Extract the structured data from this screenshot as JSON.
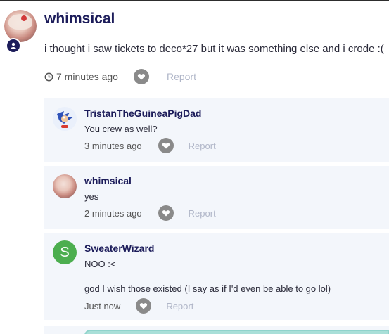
{
  "post": {
    "author": "whimsical",
    "text": "i thought i saw tickets to deco*27 but it was something else and i crode :(",
    "time": "7 minutes ago",
    "report_label": "Report"
  },
  "replies": [
    {
      "author": "TristanTheGuineaPigDad",
      "lines": [
        "You crew as well?"
      ],
      "time": "3 minutes ago",
      "report_label": "Report"
    },
    {
      "author": "whimsical",
      "lines": [
        "yes"
      ],
      "time": "2 minutes ago",
      "report_label": "Report"
    },
    {
      "author": "SweaterWizard",
      "avatar_letter": "S",
      "lines": [
        "NOO :<",
        "god I wish those existed (I say as if I'd even be able to go lol)"
      ],
      "time": "Just now",
      "report_label": "Report"
    }
  ],
  "colors": {
    "username": "#1c1c5a",
    "reply_bg": "#f3f6fb",
    "report": "#b0b6c8",
    "avatar_s": "#4cae4f",
    "input_accent": "#a9dfd8"
  }
}
